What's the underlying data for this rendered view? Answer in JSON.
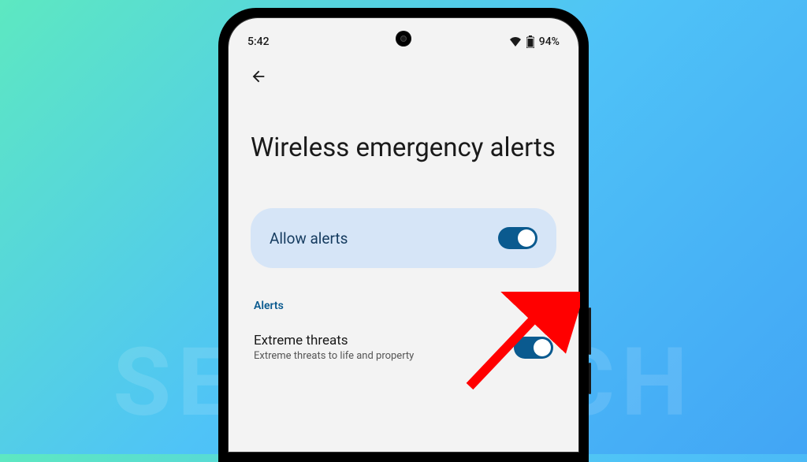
{
  "watermark": "SEEKYTECH",
  "status_bar": {
    "time": "5:42",
    "battery_pct": "94%"
  },
  "page": {
    "title": "Wireless emergency alerts"
  },
  "allow_alerts": {
    "label": "Allow alerts",
    "enabled": true
  },
  "section_label": "Alerts",
  "settings": [
    {
      "title": "Extreme threats",
      "subtitle": "Extreme threats to life and property",
      "enabled": true
    }
  ]
}
